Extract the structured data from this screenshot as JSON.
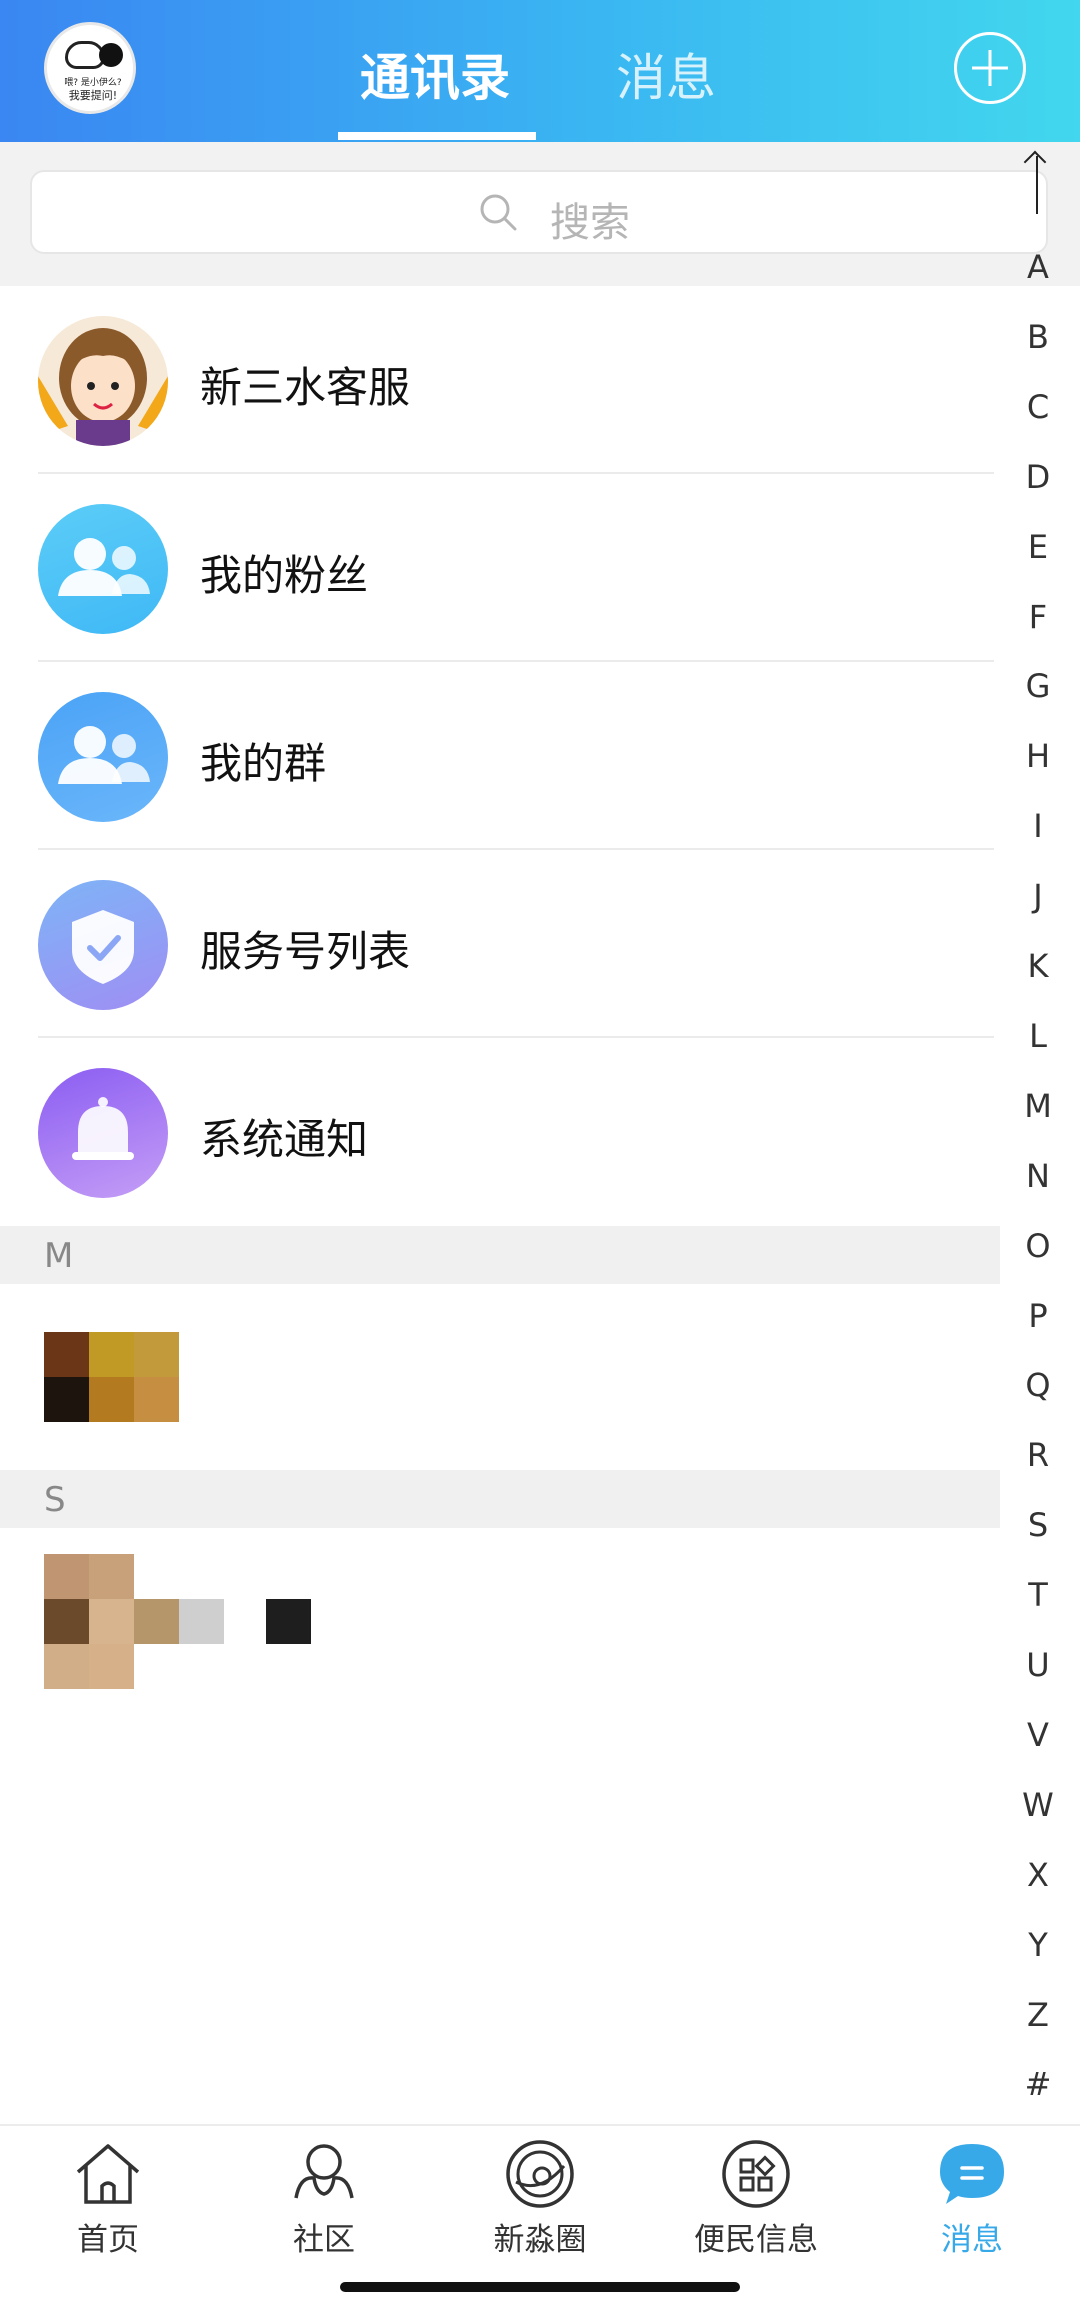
{
  "header": {
    "avatar_caption_line1": "喂? 是小伊么?",
    "avatar_caption_line2": "我要提问!",
    "tabs": [
      {
        "label": "通讯录",
        "active": true
      },
      {
        "label": "消息",
        "active": false
      }
    ],
    "add_icon": "plus-circle-icon",
    "gradient": [
      "#3a86f2",
      "#42d7ee"
    ]
  },
  "search": {
    "placeholder": "搜索",
    "icon": "search-icon"
  },
  "entries": [
    {
      "label": "新三水客服",
      "icon": "customer-service-avatar"
    },
    {
      "label": "我的粉丝",
      "icon": "people-icon"
    },
    {
      "label": "我的群",
      "icon": "group-icon"
    },
    {
      "label": "服务号列表",
      "icon": "shield-check-icon"
    },
    {
      "label": "系统通知",
      "icon": "bell-icon"
    }
  ],
  "sections": [
    {
      "letter": "M"
    },
    {
      "letter": "S"
    }
  ],
  "alphabet_index": [
    "A",
    "B",
    "C",
    "D",
    "E",
    "F",
    "G",
    "H",
    "I",
    "J",
    "K",
    "L",
    "M",
    "N",
    "O",
    "P",
    "Q",
    "R",
    "S",
    "T",
    "U",
    "V",
    "W",
    "X",
    "Y",
    "Z",
    "#"
  ],
  "bottom_nav": [
    {
      "label": "首页",
      "icon": "home-icon",
      "active": false
    },
    {
      "label": "社区",
      "icon": "community-icon",
      "active": false
    },
    {
      "label": "新淼圈",
      "icon": "planet-icon",
      "active": false
    },
    {
      "label": "便民信息",
      "icon": "grid-apps-icon",
      "active": false
    },
    {
      "label": "消息",
      "icon": "chat-bubble-icon",
      "active": true
    }
  ],
  "colors": {
    "accent": "#38a9e8",
    "section_bg": "#f0f0f0"
  }
}
